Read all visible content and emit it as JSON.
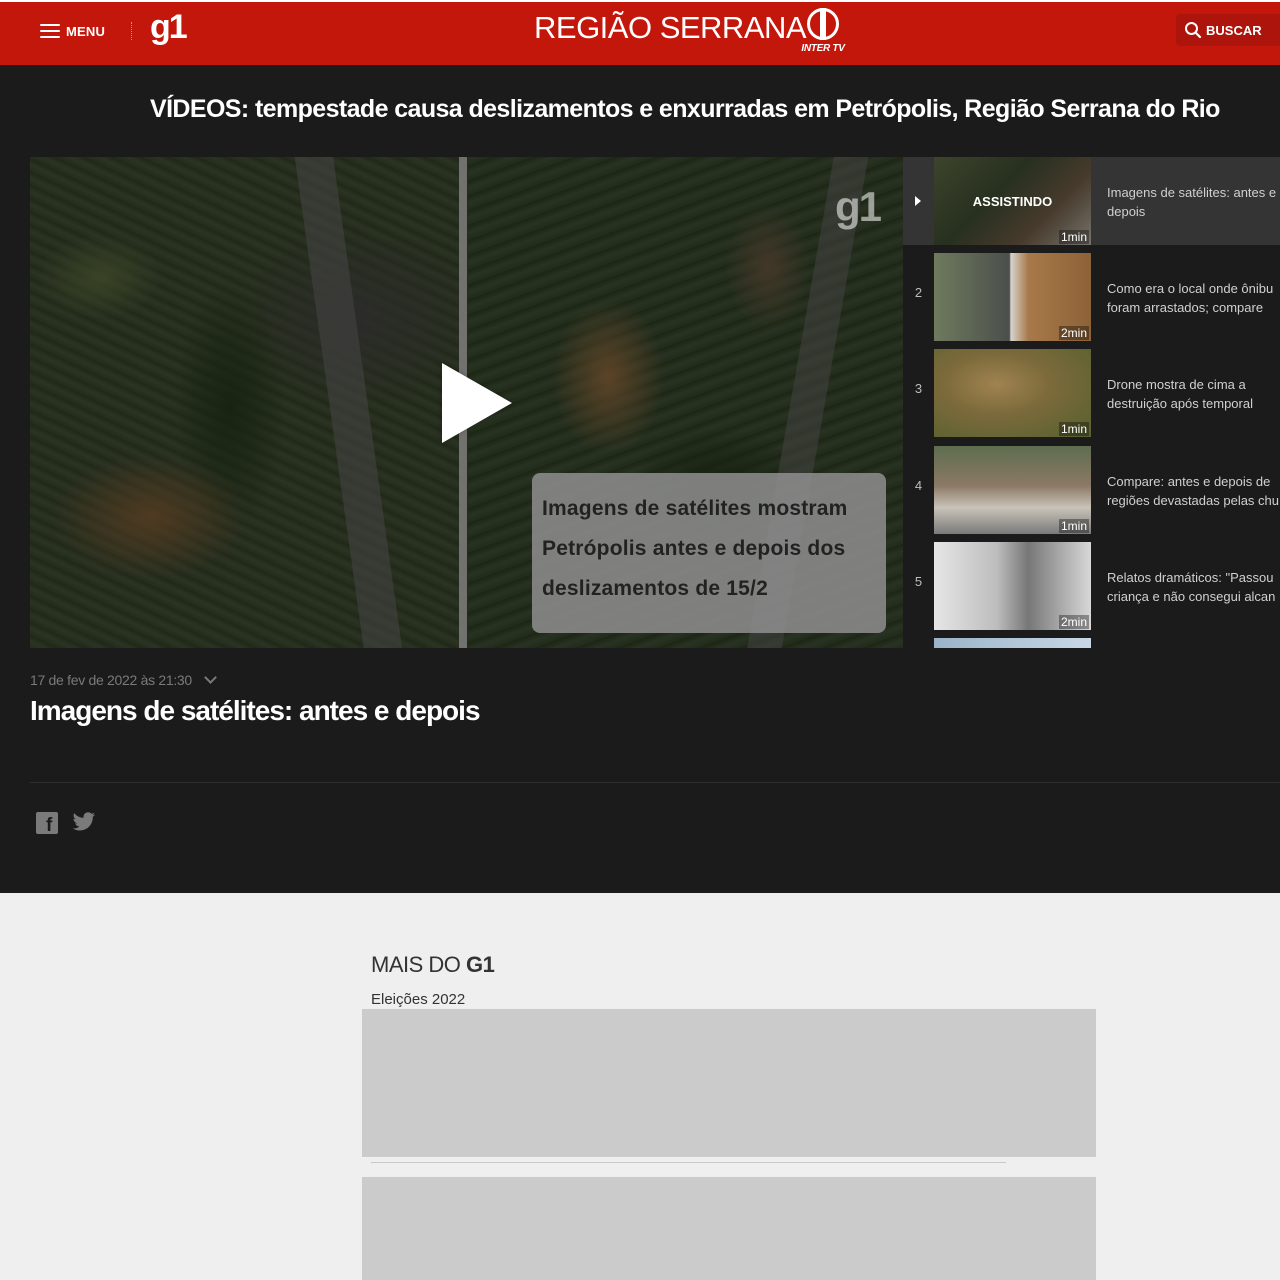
{
  "header": {
    "menu_label": "MENU",
    "logo": "g1",
    "region_title": "REGIÃO SERRANA",
    "affiliate_logo": "INTER TV",
    "search_label": "BUSCAR",
    "brand_color": "#c4170c"
  },
  "page": {
    "headline": "VÍDEOS: tempestade causa deslizamentos e enxurradas em Petrópolis, Região Serrana do Rio"
  },
  "player": {
    "watermark": "g1",
    "caption_lines": [
      "Imagens de satélites mostram",
      "Petrópolis antes e depois dos",
      "deslizamentos de 15/2"
    ]
  },
  "playlist": {
    "items": [
      {
        "num": "",
        "status": "ASSISTINDO",
        "duration": "1min",
        "title_lines": [
          "Imagens de satélites: antes e",
          "depois"
        ]
      },
      {
        "num": "2",
        "status": "",
        "duration": "2min",
        "title_lines": [
          "Como era o local onde ônibu",
          "foram arrastados; compare"
        ]
      },
      {
        "num": "3",
        "status": "",
        "duration": "1min",
        "title_lines": [
          "Drone mostra de cima a",
          "destruição após temporal"
        ]
      },
      {
        "num": "4",
        "status": "",
        "duration": "1min",
        "title_lines": [
          "Compare: antes e depois de",
          "regiões devastadas pelas chu"
        ]
      },
      {
        "num": "5",
        "status": "",
        "duration": "2min",
        "title_lines": [
          "Relatos dramáticos: \"Passou",
          "criança e não consegui alcan"
        ]
      }
    ]
  },
  "video": {
    "date": "17 de fev de 2022 às 21:30",
    "title": "Imagens de satélites: antes e depois"
  },
  "more": {
    "title_prefix": "MAIS DO",
    "title_brand": "G1",
    "section": "Eleições 2022"
  }
}
